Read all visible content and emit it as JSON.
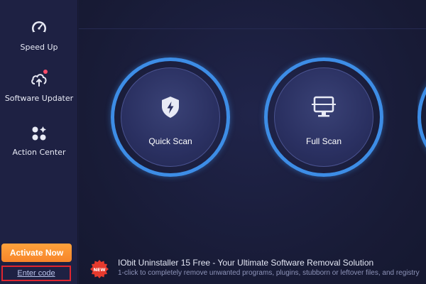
{
  "sidebar": {
    "items": [
      {
        "label": "Speed Up",
        "icon": "gauge-icon"
      },
      {
        "label": "Software Updater",
        "icon": "cloud-upload-icon"
      },
      {
        "label": "Action Center",
        "icon": "action-center-icon"
      }
    ],
    "activate_label": "Activate Now",
    "enter_code_label": "Enter code"
  },
  "main": {
    "scan_buttons": [
      {
        "label": "Quick Scan",
        "icon": "shield-lightning-icon"
      },
      {
        "label": "Full Scan",
        "icon": "monitor-scan-icon"
      }
    ]
  },
  "promo": {
    "badge": "NEW",
    "title": "IObit Uninstaller 15 Free - Your Ultimate Software Removal Solution",
    "subtitle": "1-click to completely remove unwanted programs, plugins, stubborn or leftover files, and registry"
  },
  "colors": {
    "accent_blue": "#3d8de6",
    "activate_orange": "#f7852a",
    "highlight_red": "#e0252f",
    "notification_dot": "#ff4d6a"
  }
}
